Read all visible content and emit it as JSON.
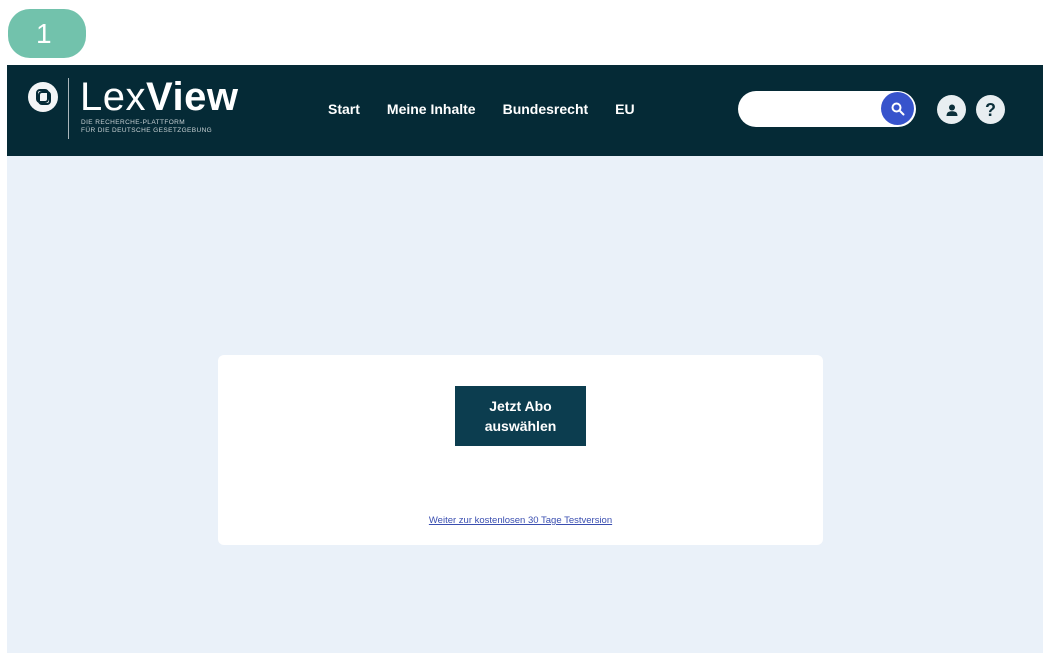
{
  "step": {
    "number": "1"
  },
  "header": {
    "logo": {
      "name_light": "Lex",
      "name_bold": "View",
      "tagline_line1": "DIE RECHERCHE-PLATTFORM",
      "tagline_line2": "FÜR DIE DEUTSCHE GESETZGEBUNG",
      "icon": "lexview-logo-icon"
    },
    "nav": [
      {
        "label": "Start"
      },
      {
        "label": "Meine Inhalte"
      },
      {
        "label": "Bundesrecht"
      },
      {
        "label": "EU"
      }
    ],
    "search": {
      "value": "",
      "placeholder": "",
      "icon": "search-icon"
    },
    "account_icon": "user-icon",
    "help_icon": "help-icon"
  },
  "card": {
    "cta_label": "Jetzt Abo auswählen",
    "trial_link": "Weiter zur kostenlosen 30 Tage Testversion"
  },
  "colors": {
    "header_bg": "#052a36",
    "page_bg": "#eaf1f9",
    "cta_bg": "#0c3d4f",
    "search_accent": "#3753cc",
    "step_badge": "#72c2ac"
  }
}
